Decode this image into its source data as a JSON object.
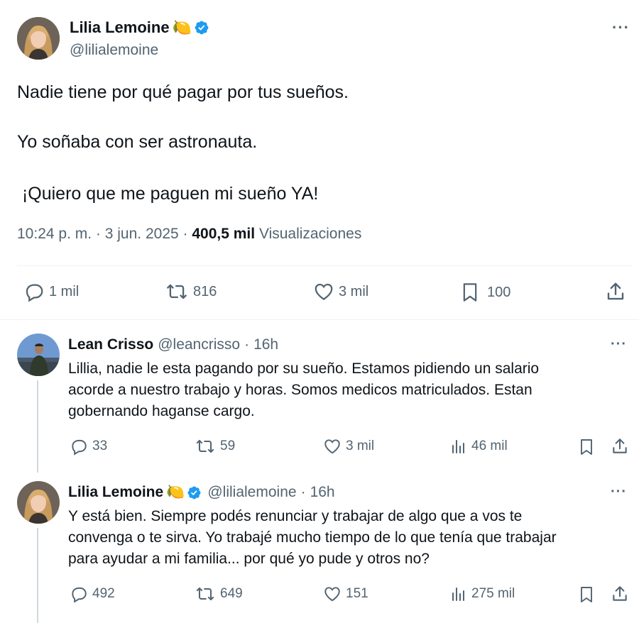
{
  "main_tweet": {
    "author": {
      "name": "Lilia Lemoine",
      "handle": "@lilialemoine",
      "emoji": "🍋"
    },
    "text_lines": [
      "Nadie tiene por qué pagar por tus sueños.",
      "Yo soñaba con ser astronauta.",
      " ¡Quiero que me paguen mi sueño YA!"
    ],
    "time": "10:24 p. m.",
    "date": "3 jun. 2025",
    "views_count": "400,5 mil",
    "views_label": "Visualizaciones",
    "replies": "1 mil",
    "reposts": "816",
    "likes": "3 mil",
    "bookmarks": "100"
  },
  "replies": [
    {
      "author": {
        "name": "Lean Crisso",
        "handle": "@leancrisso",
        "time": "16h"
      },
      "text_lines": [
        "Lillia, nadie le esta pagando por su sueño. Estamos pidiendo un salario",
        "acorde a nuestro trabajo y horas. Somos medicos matriculados. Estan",
        "gobernando haganse cargo."
      ],
      "replies": "33",
      "reposts": "59",
      "likes": "3 mil",
      "views": "46 mil"
    },
    {
      "author": {
        "name": "Lilia Lemoine",
        "emoji": "🍋",
        "handle": "@lilialemoine",
        "time": "16h"
      },
      "text_lines": [
        "Y está bien. Siempre podés renunciar y trabajar de algo que a vos te",
        "convenga o te sirva. Yo trabajé mucho tiempo de lo que tenía que trabajar",
        "para ayudar a mi familia... por qué yo pude y otros no?"
      ],
      "replies": "492",
      "reposts": "649",
      "likes": "151",
      "views": "275 mil"
    }
  ],
  "separator": "·",
  "more_label": "···",
  "colors": {
    "verified": "#1d9bf0",
    "secondary": "#536471",
    "text": "#0f1419",
    "divider": "#eff3f4"
  },
  "icons": [
    "verified-badge-icon",
    "more-icon",
    "reply-icon",
    "repost-icon",
    "like-icon",
    "bookmark-icon",
    "share-icon",
    "views-icon"
  ]
}
